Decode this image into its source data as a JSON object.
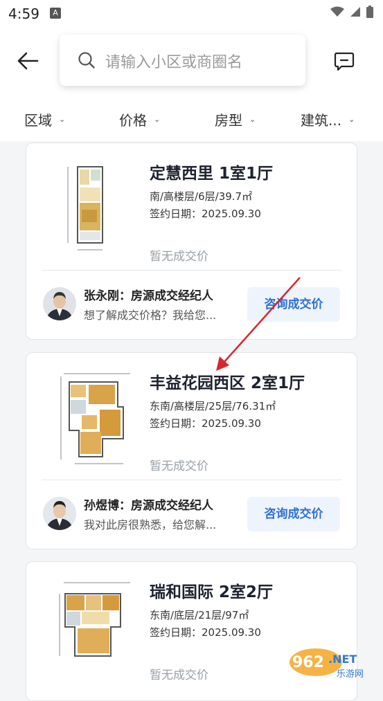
{
  "status_bar": {
    "time": "4:59",
    "notif_icon": "A"
  },
  "header": {
    "search_placeholder": "请输入小区或商圈名"
  },
  "filters": [
    {
      "label": "区域"
    },
    {
      "label": "价格"
    },
    {
      "label": "房型"
    },
    {
      "label": "建筑..."
    }
  ],
  "listings": [
    {
      "title": "定慧西里 1室1厅",
      "info": "南/高楼层/6层/39.7㎡",
      "date": "签约日期：2025.09.30",
      "price_status": "暂无成交价",
      "agent_name": "张永刚：房源成交经纪人",
      "agent_message": "想了解成交价格？我给您...",
      "button_label": "咨询成交价"
    },
    {
      "title": "丰益花园西区 2室1厅",
      "info": "东南/高楼层/25层/76.31㎡",
      "date": "签约日期：2025.09.30",
      "price_status": "暂无成交价",
      "agent_name": "孙煜博：房源成交经纪人",
      "agent_message": "我对此房很熟悉，给您解...",
      "button_label": "咨询成交价"
    },
    {
      "title": "瑞和国际 2室2厅",
      "info": "东南/底层/21层/97㎡",
      "date": "签约日期：2025.09.30",
      "price_status": "暂无成交价"
    }
  ],
  "watermark": {
    "text": "962.NET",
    "sub": "乐游网"
  },
  "colors": {
    "accent": "#2f6fd6",
    "button_bg": "#eef4fd",
    "annotation": "#d9262b"
  }
}
